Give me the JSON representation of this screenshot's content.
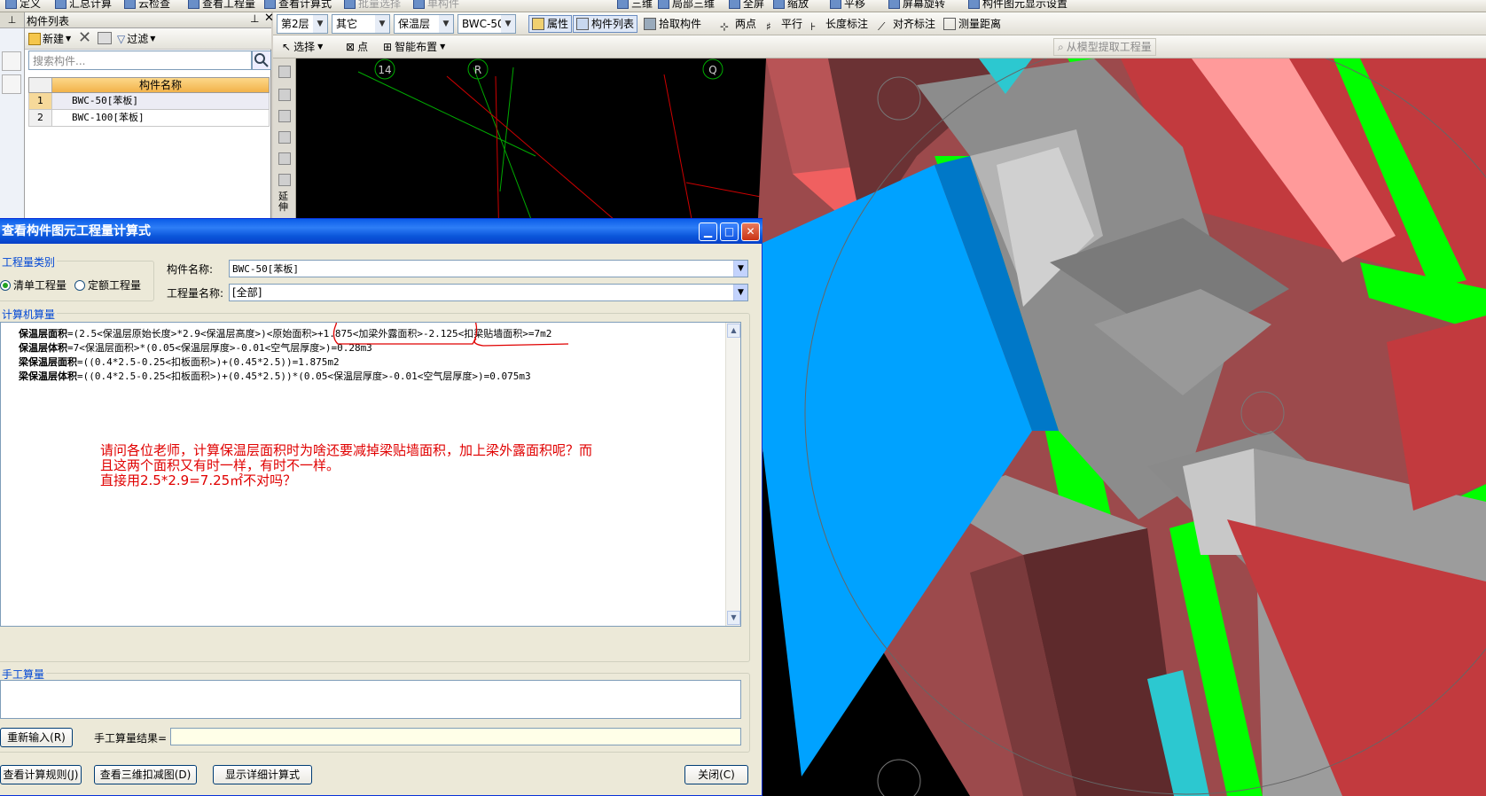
{
  "top_toolbar": {
    "items": [
      "定义",
      "汇总计算",
      "云检查",
      "查看工程量",
      "查看计算式",
      "批量选择",
      "单构件",
      "三维",
      "局部三维",
      "全屏",
      "缩放",
      "平移",
      "屏幕旋转",
      "构件图元显示设置"
    ]
  },
  "component_list": {
    "title": "构件列表",
    "tools": {
      "new": "新建",
      "filter": "过滤"
    },
    "search_placeholder": "搜索构件...",
    "column_header": "构件名称",
    "rows": [
      {
        "num": "1",
        "name": "BWC-50[苯板]"
      },
      {
        "num": "2",
        "name": "BWC-100[苯板]"
      }
    ]
  },
  "toolbar1": {
    "floor": "第2层",
    "category": "其它",
    "type": "保温层",
    "component": "BWC-50[苯",
    "attr_btn": "属性",
    "list_btn": "构件列表",
    "pick_btn": "拾取构件",
    "two_point": "两点",
    "parallel": "平行",
    "length_dim": "长度标注",
    "align_dim": "对齐标注",
    "measure": "测量距离"
  },
  "toolbar2": {
    "select": "选择",
    "point": "点",
    "smart": "智能布置",
    "extract": "从模型提取工程量"
  },
  "side_tool": {
    "extend": "延伸"
  },
  "axis_labels": [
    "14",
    "R",
    "Q"
  ],
  "dialog": {
    "title": "查看构件图元工程量计算式",
    "qty_type_legend": "工程量类别",
    "radio1": "清单工程量",
    "radio2": "定额工程量",
    "comp_name_label": "构件名称:",
    "comp_name_value": "BWC-50[苯板]",
    "qty_name_label": "工程量名称:",
    "qty_name_value": "[全部]",
    "computer_legend": "计算机算量",
    "formulas": [
      {
        "name": "保温层面积",
        "expr": "=(2.5<保温层原始长度>*2.9<保温层高度>)<原始面积>+1.875<加梁外露面积>-2.125<扣梁贴墙面积>=7m2"
      },
      {
        "name": "保温层体积",
        "expr": "=7<保温层面积>*(0.05<保温层厚度>-0.01<空气层厚度>)=0.28m3"
      },
      {
        "name": "梁保温层面积",
        "expr": "=((0.4*2.5-0.25<扣板面积>)+(0.45*2.5))=1.875m2"
      },
      {
        "name": "梁保温层体积",
        "expr": "=((0.4*2.5-0.25<扣板面积>)+(0.45*2.5))*(0.05<保温层厚度>-0.01<空气层厚度>)=0.075m3"
      }
    ],
    "question_lines": [
      "请问各位老师，计算保温层面积时为啥还要减掉梁贴墙面积，加上梁外露面积呢？而",
      "且这两个面积又有时一样，有时不一样。",
      "直接用2.5*2.9=7.25㎡不对吗？"
    ],
    "manual_legend": "手工算量",
    "reinput_btn": "重新输入(R)",
    "manual_result_label": "手工算量结果=",
    "rules_btn": "查看计算规则(J)",
    "view3d_btn": "查看三维扣减图(D)",
    "detail_btn": "显示详细计算式",
    "close_btn": "关闭(C)"
  },
  "colors": {
    "dialog_title": "#0a5ce8",
    "annotation_red": "#e00000",
    "wall_red": "#c0393b",
    "insulation_green": "#00ff00",
    "slab_blue": "#00a2ff",
    "beam_gray": "#8c8c8c"
  }
}
